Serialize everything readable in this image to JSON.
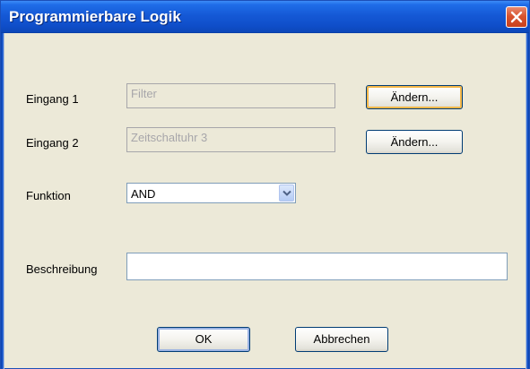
{
  "window": {
    "title": "Programmierbare Logik"
  },
  "form": {
    "input1": {
      "label": "Eingang 1",
      "value": "Filter",
      "button": "Ändern..."
    },
    "input2": {
      "label": "Eingang 2",
      "value": "Zeitschaltuhr 3",
      "button": "Ändern..."
    },
    "function": {
      "label": "Funktion",
      "value": "AND"
    },
    "description": {
      "label": "Beschreibung",
      "value": ""
    }
  },
  "actions": {
    "ok": "OK",
    "cancel": "Abbrechen"
  },
  "icons": {
    "close": "close-icon",
    "dropdown": "chevron-down-icon"
  },
  "colors": {
    "titlebar": "#1559d6",
    "dialog_bg": "#ece9d8",
    "close_button": "#d9542f",
    "focus_ring": "#f5b84a"
  }
}
